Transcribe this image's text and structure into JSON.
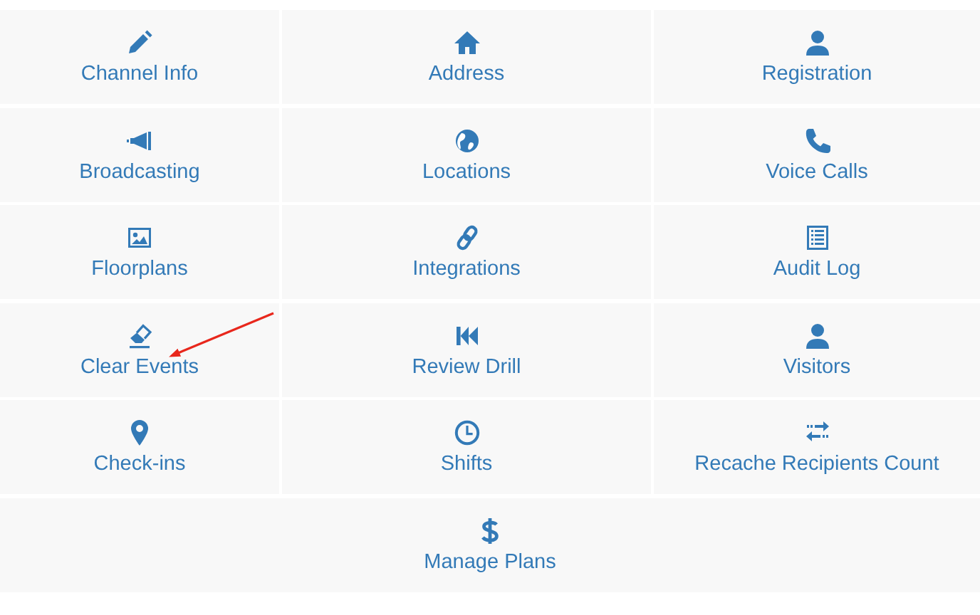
{
  "menu_items": [
    {
      "label": "Channel Info"
    },
    {
      "label": "Address"
    },
    {
      "label": "Registration"
    },
    {
      "label": "Broadcasting"
    },
    {
      "label": "Locations"
    },
    {
      "label": "Voice Calls"
    },
    {
      "label": "Floorplans"
    },
    {
      "label": "Integrations"
    },
    {
      "label": "Audit Log"
    },
    {
      "label": "Clear Events"
    },
    {
      "label": "Review Drill"
    },
    {
      "label": "Visitors"
    },
    {
      "label": "Check-ins"
    },
    {
      "label": "Shifts"
    },
    {
      "label": "Recache Recipients Count"
    },
    {
      "label": "Manage Plans"
    }
  ]
}
